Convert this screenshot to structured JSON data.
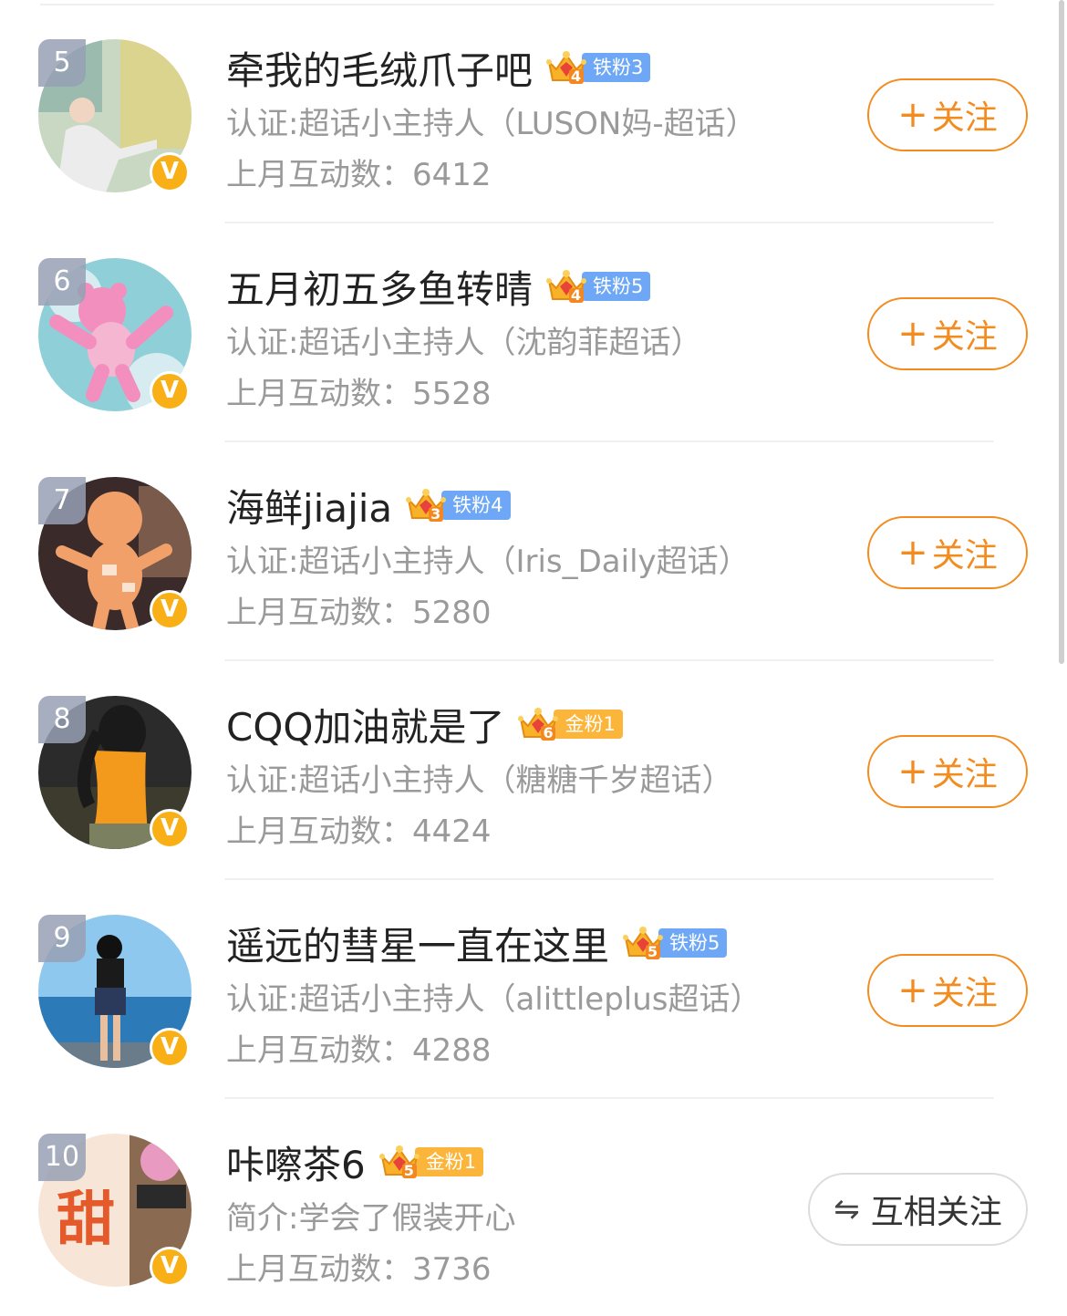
{
  "rows": [
    {
      "rank": "5",
      "name": "牵我的毛绒爪子吧",
      "crown_level": "4",
      "fan_label": "铁粉3",
      "fan_type": "iron",
      "desc": "认证:超话小主持人（LUSON妈-超话）",
      "stat": "上月互动数：6412",
      "button": "关注",
      "avatar_icon": "avatar-painting-man",
      "avatar_colors": [
        "#c9d8c3",
        "#e8d26a",
        "#6f9d9b",
        "#ececec"
      ]
    },
    {
      "rank": "6",
      "name": "五月初五多鱼转晴",
      "crown_level": "4",
      "fan_label": "铁粉5",
      "fan_type": "iron",
      "desc": "认证:超话小主持人（沈韵菲超话）",
      "stat": "上月互动数：5528",
      "button": "关注",
      "avatar_icon": "avatar-pink-bear",
      "avatar_colors": [
        "#8fd0d8",
        "#f5b6d1",
        "#f28fbf",
        "#d6ecf0"
      ]
    },
    {
      "rank": "7",
      "name": "海鲜jiajia",
      "crown_level": "3",
      "fan_label": "铁粉4",
      "fan_type": "iron",
      "desc": "认证:超话小主持人（Iris_Daily超话）",
      "stat": "上月互动数：5280",
      "button": "关注",
      "avatar_icon": "avatar-doll",
      "avatar_colors": [
        "#3a2a2a",
        "#f2a06a",
        "#e8c7a8",
        "#7a5a4a"
      ]
    },
    {
      "rank": "8",
      "name": "CQQ加油就是了",
      "crown_level": "6",
      "fan_label": "金粉1",
      "fan_type": "gold",
      "desc": "认证:超话小主持人（糖糖千岁超话）",
      "stat": "上月互动数：4424",
      "button": "关注",
      "avatar_icon": "avatar-girl-orange",
      "avatar_colors": [
        "#2b2b2b",
        "#f39a1d",
        "#7a8060",
        "#d8c1a8"
      ]
    },
    {
      "rank": "9",
      "name": "遥远的彗星一直在这里",
      "crown_level": "5",
      "fan_label": "铁粉5",
      "fan_type": "iron",
      "desc": "认证:超话小主持人（alittleplus超话）",
      "stat": "上月互动数：4288",
      "button": "关注",
      "avatar_icon": "avatar-girl-sea",
      "avatar_colors": [
        "#8fc8ef",
        "#2c7bb8",
        "#2b3a5a",
        "#b9d9f2"
      ]
    },
    {
      "rank": "10",
      "name": "咔嚓茶6",
      "crown_level": "5",
      "fan_label": "金粉1",
      "fan_type": "gold",
      "desc": "简介:学会了假装开心",
      "stat": "上月互动数：3736",
      "button": "互相关注",
      "avatar_icon": "avatar-sweet-sign",
      "avatar_colors": [
        "#f7e6d8",
        "#e55a2b",
        "#8b6a52",
        "#e89ac0"
      ]
    }
  ]
}
